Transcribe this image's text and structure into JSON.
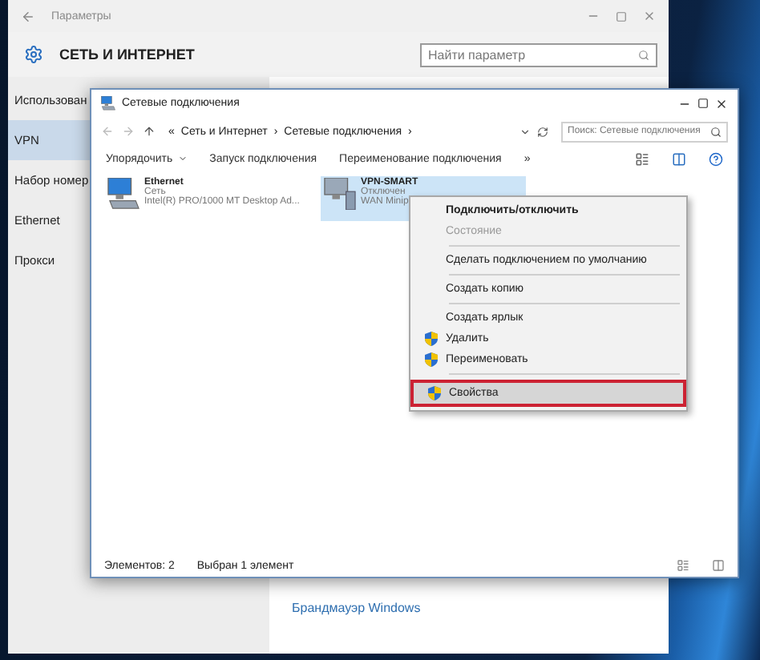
{
  "settings": {
    "title": "Параметры",
    "heading": "СЕТЬ И ИНТЕРНЕТ",
    "search_placeholder": "Найти параметр",
    "sidebar": [
      {
        "label": "Использован",
        "selected": false
      },
      {
        "label": "VPN",
        "selected": true
      },
      {
        "label": "Набор номер",
        "selected": false
      },
      {
        "label": "Ethernet",
        "selected": false
      },
      {
        "label": "Прокси",
        "selected": false
      }
    ],
    "links": [
      "Брандмауэр Windows"
    ]
  },
  "explorer": {
    "title": "Сетевые подключения",
    "breadcrumbs": [
      "«",
      "Сеть и Интернет",
      "›",
      "Сетевые подключения",
      "›"
    ],
    "search_placeholder": "Поиск: Сетевые подключения",
    "toolbar": [
      {
        "label": "Упорядочить",
        "dropdown": true
      },
      {
        "label": "Запуск подключения",
        "dropdown": false
      },
      {
        "label": "Переименование подключения",
        "dropdown": false
      },
      {
        "label": "»",
        "dropdown": false
      }
    ],
    "items": [
      {
        "name": "Ethernet",
        "lines": [
          "Сеть",
          "Intel(R) PRO/1000 MT Desktop Ad..."
        ],
        "selected": false,
        "kind": "ethernet"
      },
      {
        "name": "VPN-SMART",
        "lines": [
          "Отключен",
          "WAN Minip"
        ],
        "selected": true,
        "kind": "vpn"
      }
    ],
    "status": [
      "Элементов: 2",
      "Выбран 1 элемент"
    ]
  },
  "context_menu": [
    {
      "kind": "item",
      "label": "Подключить/отключить",
      "bold": true,
      "disabled": false,
      "shield": false,
      "highlighted": false
    },
    {
      "kind": "item",
      "label": "Состояние",
      "bold": false,
      "disabled": true,
      "shield": false,
      "highlighted": false
    },
    {
      "kind": "separator"
    },
    {
      "kind": "item",
      "label": "Сделать подключением по умолчанию",
      "bold": false,
      "disabled": false,
      "shield": false,
      "highlighted": false
    },
    {
      "kind": "separator"
    },
    {
      "kind": "item",
      "label": "Создать копию",
      "bold": false,
      "disabled": false,
      "shield": false,
      "highlighted": false
    },
    {
      "kind": "separator"
    },
    {
      "kind": "item",
      "label": "Создать ярлык",
      "bold": false,
      "disabled": false,
      "shield": false,
      "highlighted": false
    },
    {
      "kind": "item",
      "label": "Удалить",
      "bold": false,
      "disabled": false,
      "shield": true,
      "highlighted": false
    },
    {
      "kind": "item",
      "label": "Переименовать",
      "bold": false,
      "disabled": false,
      "shield": true,
      "highlighted": false
    },
    {
      "kind": "separator"
    },
    {
      "kind": "item",
      "label": "Свойства",
      "bold": false,
      "disabled": false,
      "shield": true,
      "highlighted": true
    }
  ]
}
